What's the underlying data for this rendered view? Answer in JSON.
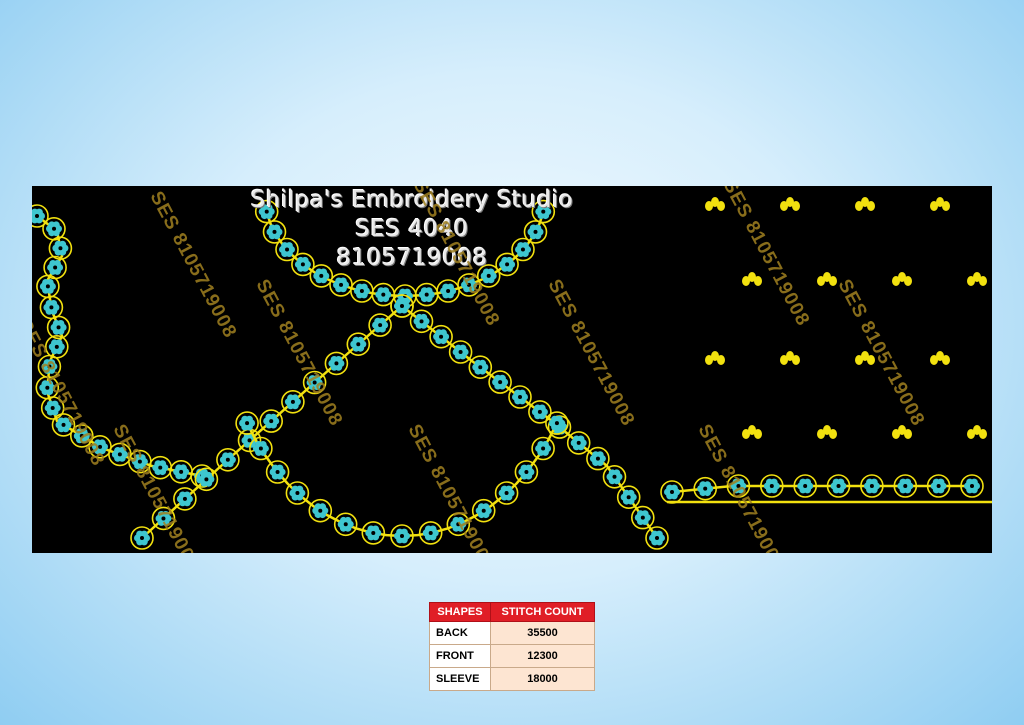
{
  "brand": {
    "name": "Shilpa's Embroidery Studio",
    "code": "SES 4040",
    "phone": "8105719008"
  },
  "watermark": "SES 8105719008",
  "table": {
    "headers": [
      "SHAPES",
      "STITCH COUNT"
    ],
    "rows": [
      {
        "shape": "BACK",
        "count": "35500"
      },
      {
        "shape": "FRONT",
        "count": "12300"
      },
      {
        "shape": "SLEEVE",
        "count": "18000"
      }
    ]
  },
  "colors": {
    "background": "#000000",
    "thread_gold": "#f2e10f",
    "thread_cyan": "#3ec6cf",
    "header_red": "#e01e26",
    "cell_peach": "#fde5d2"
  }
}
